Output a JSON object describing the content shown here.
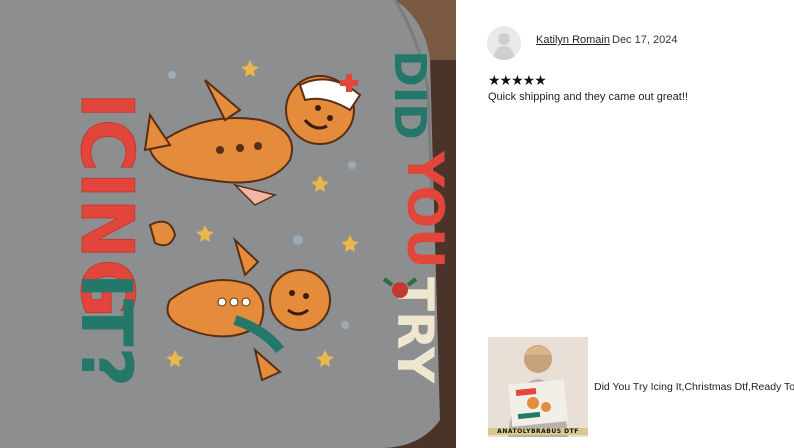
{
  "review": {
    "reviewer_name": "Katilyn Romain",
    "date": "Dec 17, 2024",
    "stars": "★★★★★",
    "rating": 5,
    "text": "Quick shipping and they came out great!!"
  },
  "shirt_print": {
    "left_words": [
      "ICING",
      "IT?"
    ],
    "right_words": [
      "DID",
      "YOU",
      "TRY"
    ]
  },
  "product": {
    "title": "Did You Try Icing It,Christmas Dtf,Ready To",
    "thumb_caption": "ANATOLYBRABUS DTF"
  },
  "colors": {
    "shirt": "#8c8e8f",
    "red_text": "#e2453a",
    "teal_text": "#23786a",
    "cream_text": "#efe6cf",
    "cookie": "#e48c3c"
  },
  "icons": {
    "avatar": "user-silhouette-icon"
  }
}
